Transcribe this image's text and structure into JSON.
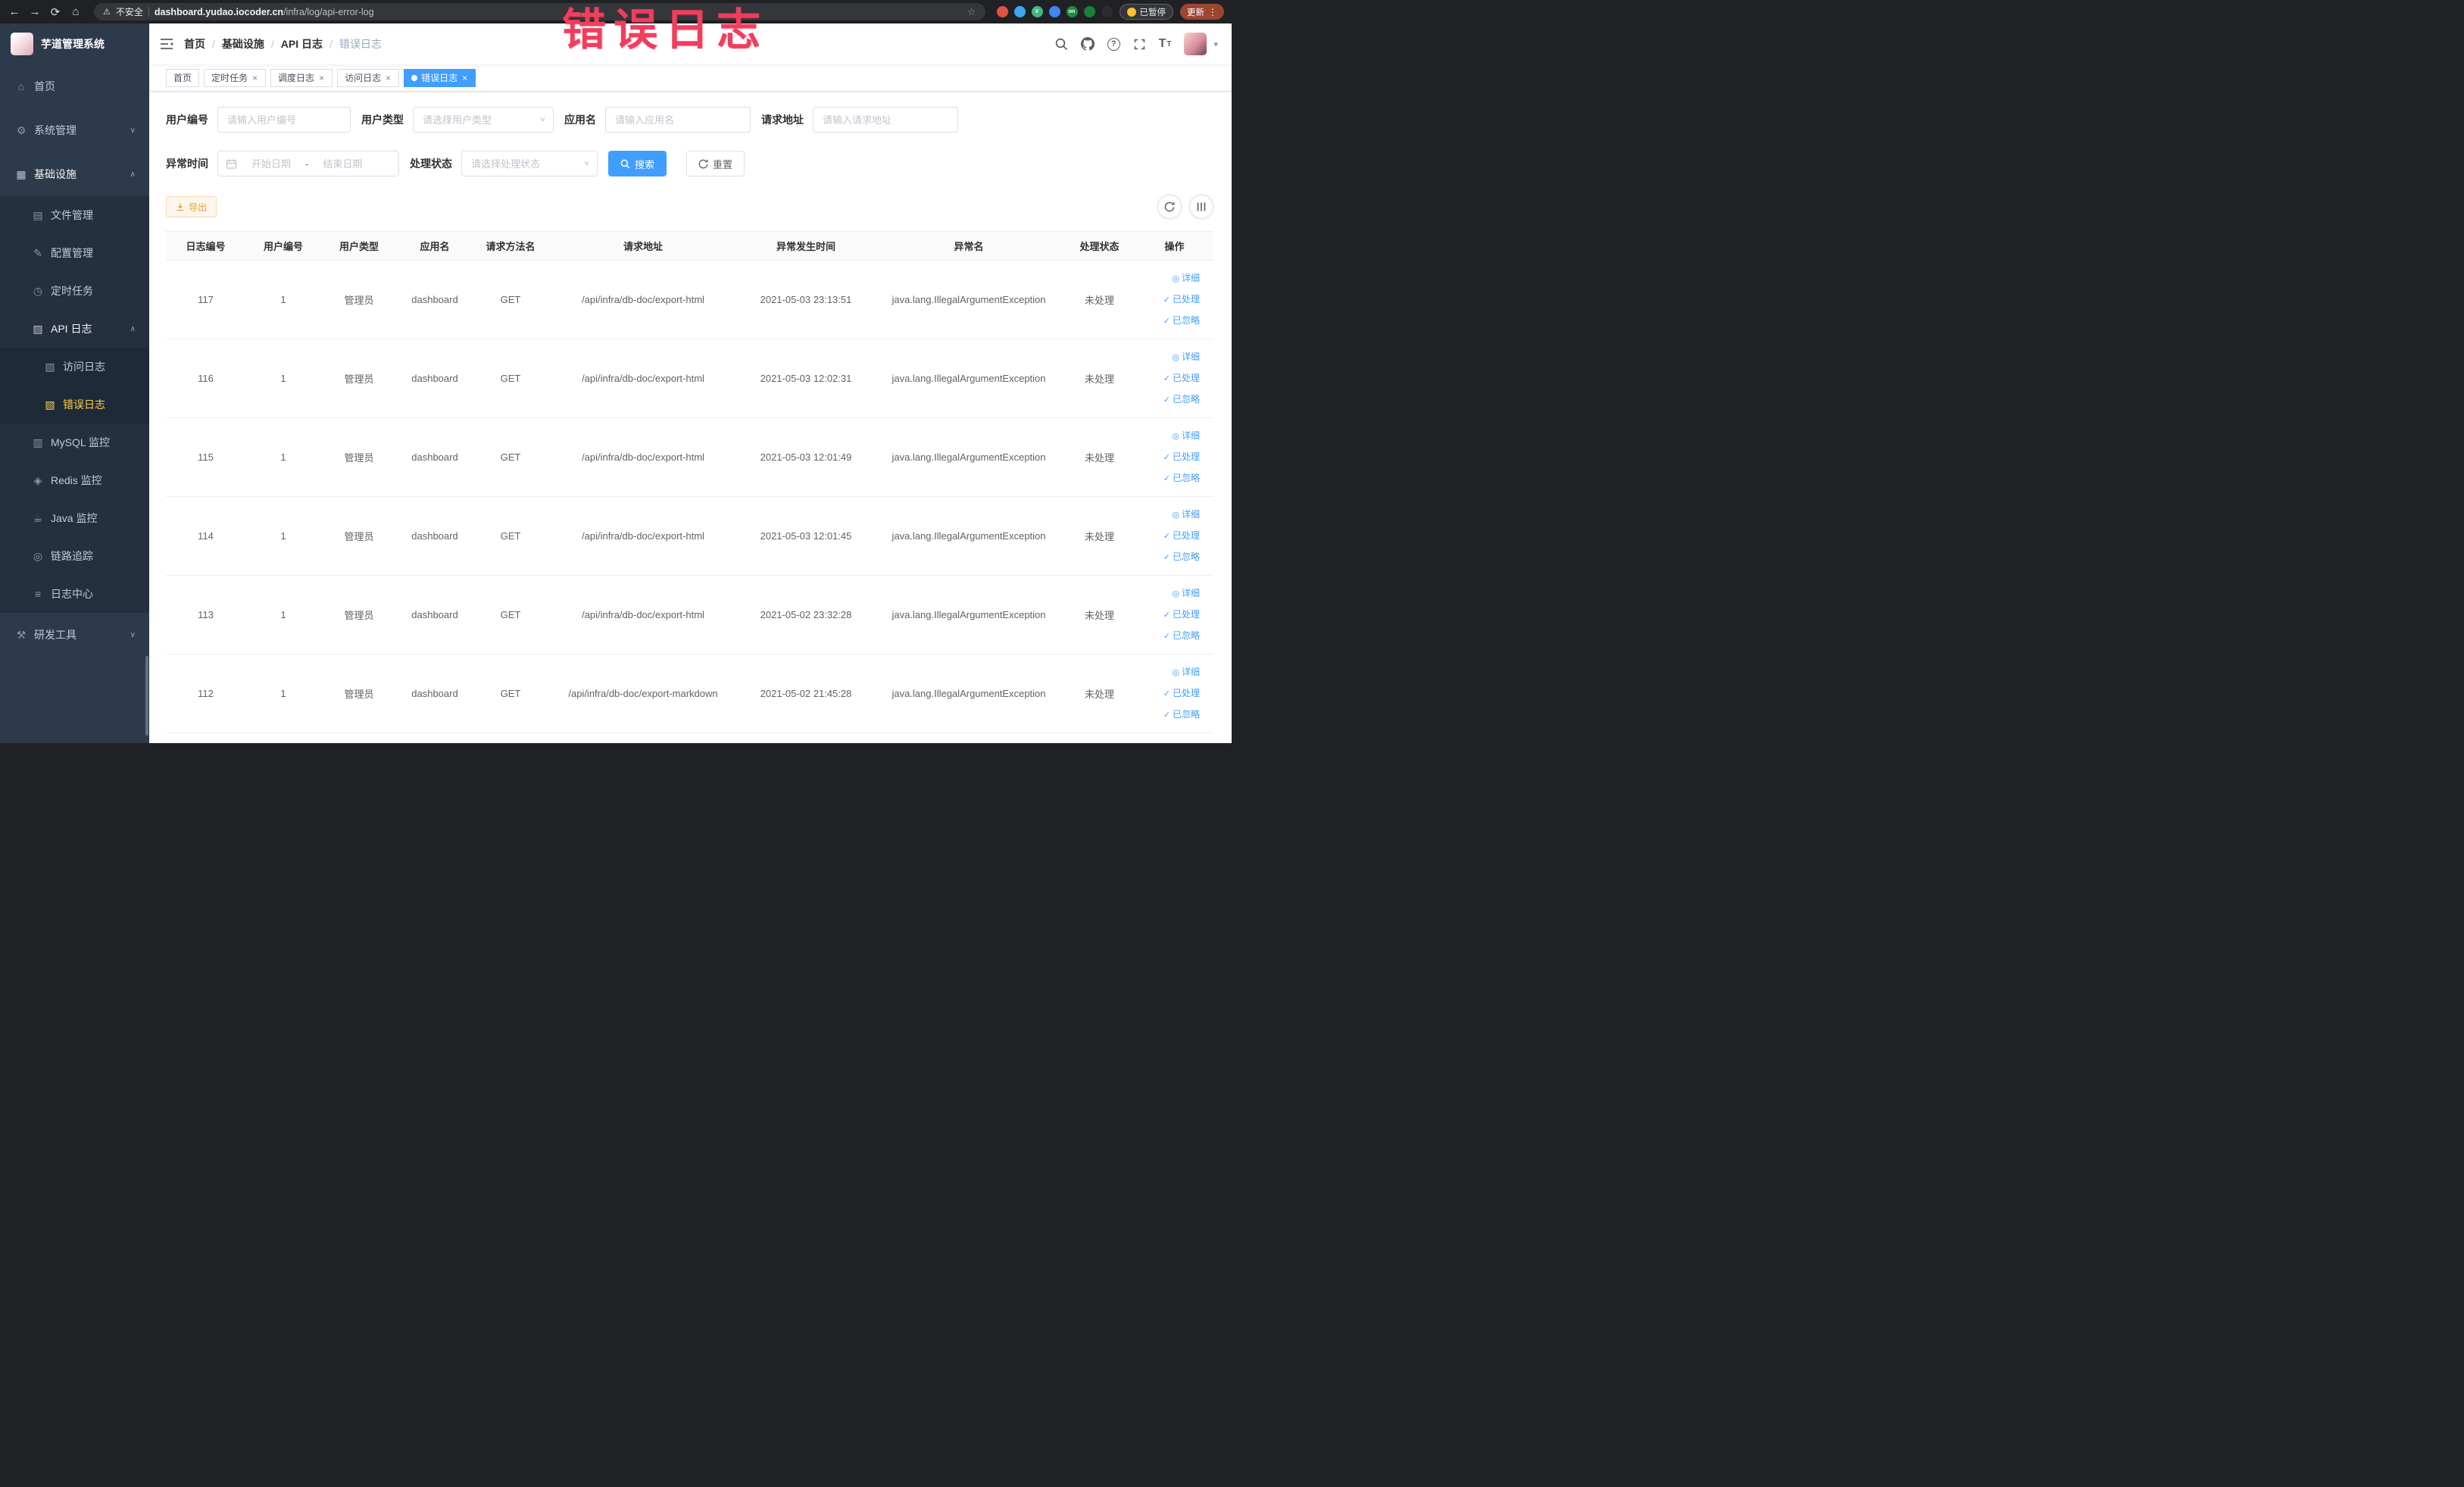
{
  "colors": {
    "accent": "#409eff",
    "active_menu_text": "#ffd04b",
    "sidebar_bg": "#2d3a4b",
    "submenu_bg": "#24303f",
    "warning": "#e6a23c",
    "annotation": "#f23d5d"
  },
  "browser": {
    "security_label": "不安全",
    "url_host": "dashboard.yudao.iocoder.cn",
    "url_path": "/infra/log/api-error-log",
    "paused_label": "已暂停",
    "update_label": "更新",
    "extensions": [
      {
        "name": "extension-icon-red",
        "color": "#e25241"
      },
      {
        "name": "extension-icon-blue-drop",
        "color": "#3ba7f0"
      },
      {
        "name": "extension-icon-vue",
        "color": "#41b883",
        "text": "V"
      },
      {
        "name": "extension-icon-grid",
        "color": "#4285f4"
      },
      {
        "name": "extension-icon-on",
        "color": "#1e8e3e",
        "text": "on"
      },
      {
        "name": "extension-icon-leaf",
        "color": "#188038"
      },
      {
        "name": "extension-icon-paw",
        "color": "#2d2d2d"
      }
    ]
  },
  "annotation": {
    "text": "错误日志",
    "color": "#f23d5d"
  },
  "icons": {
    "home-icon": "⌂",
    "gear-icon": "⚙",
    "infra-icon": "▦",
    "file-icon": "▤",
    "config-icon": "✎",
    "job-icon": "◷",
    "api-log-icon": "▨",
    "access-log-icon": "▧",
    "error-log-icon": "▧",
    "mysql-icon": "▥",
    "redis-icon": "◈",
    "java-icon": "☕",
    "trace-icon": "◎",
    "log-center-icon": "≡",
    "tools-icon": "⚒",
    "eye-icon": "◎",
    "check-icon": "✓",
    "arrow-up": "∧",
    "arrow-down": "∨"
  },
  "sidebar": {
    "logo_title": "芋道管理系统",
    "items": [
      {
        "name": "home",
        "label": "首页",
        "icon": "home-icon",
        "level": 0
      },
      {
        "name": "system",
        "label": "系统管理",
        "icon": "gear-icon",
        "level": 0,
        "arrow": "down"
      },
      {
        "name": "infra",
        "label": "基础设施",
        "icon": "infra-icon",
        "level": 0,
        "arrow": "up",
        "open": true
      },
      {
        "name": "file-manage",
        "label": "文件管理",
        "icon": "file-icon",
        "level": 1
      },
      {
        "name": "config-manage",
        "label": "配置管理",
        "icon": "config-icon",
        "level": 1
      },
      {
        "name": "scheduled-job",
        "label": "定时任务",
        "icon": "job-icon",
        "level": 1
      },
      {
        "name": "api-log",
        "label": "API 日志",
        "icon": "api-log-icon",
        "level": 1,
        "arrow": "up",
        "open": true
      },
      {
        "name": "access-log",
        "label": "访问日志",
        "icon": "access-log-icon",
        "level": 2
      },
      {
        "name": "error-log",
        "label": "错误日志",
        "icon": "error-log-icon",
        "level": 2,
        "active": true
      },
      {
        "name": "mysql-monitor",
        "label": "MySQL 监控",
        "icon": "mysql-icon",
        "level": 1
      },
      {
        "name": "redis-monitor",
        "label": "Redis 监控",
        "icon": "redis-icon",
        "level": 1
      },
      {
        "name": "java-monitor",
        "label": "Java 监控",
        "icon": "java-icon",
        "level": 1
      },
      {
        "name": "link-trace",
        "label": "链路追踪",
        "icon": "trace-icon",
        "level": 1
      },
      {
        "name": "log-center",
        "label": "日志中心",
        "icon": "log-center-icon",
        "level": 1
      },
      {
        "name": "dev-tools",
        "label": "研发工具",
        "icon": "tools-icon",
        "level": 0,
        "arrow": "down"
      }
    ]
  },
  "header": {
    "breadcrumbs": [
      {
        "name": "crumb-home",
        "label": "首页"
      },
      {
        "name": "crumb-infra",
        "label": "基础设施"
      },
      {
        "name": "crumb-api-log",
        "label": "API 日志"
      },
      {
        "name": "crumb-error-log",
        "label": "错误日志",
        "current": true
      }
    ]
  },
  "tags": [
    {
      "name": "tab-home",
      "label": "首页",
      "closable": false
    },
    {
      "name": "tab-scheduled-job",
      "label": "定时任务",
      "closable": true
    },
    {
      "name": "tab-schedule-log",
      "label": "调度日志",
      "closable": true
    },
    {
      "name": "tab-access-log",
      "label": "访问日志",
      "closable": true
    },
    {
      "name": "tab-error-log",
      "label": "错误日志",
      "closable": true,
      "active": true
    }
  ],
  "filters": {
    "user_id": {
      "label": "用户编号",
      "placeholder": "请输入用户编号"
    },
    "user_type": {
      "label": "用户类型",
      "placeholder": "请选择用户类型"
    },
    "app_name": {
      "label": "应用名",
      "placeholder": "请输入应用名"
    },
    "request_url": {
      "label": "请求地址",
      "placeholder": "请输入请求地址"
    },
    "exception_time": {
      "label": "异常时间",
      "start_placeholder": "开始日期",
      "end_placeholder": "结束日期",
      "separator": "-"
    },
    "process_status": {
      "label": "处理状态",
      "placeholder": "请选择处理状态"
    },
    "search_label": "搜索",
    "reset_label": "重置"
  },
  "toolbar": {
    "export_label": "导出"
  },
  "table": {
    "columns": [
      {
        "key": "id",
        "label": "日志编号"
      },
      {
        "key": "user_id",
        "label": "用户编号"
      },
      {
        "key": "user_type",
        "label": "用户类型"
      },
      {
        "key": "app",
        "label": "应用名"
      },
      {
        "key": "method",
        "label": "请求方法名"
      },
      {
        "key": "url",
        "label": "请求地址"
      },
      {
        "key": "time",
        "label": "异常发生时间"
      },
      {
        "key": "exception",
        "label": "异常名"
      },
      {
        "key": "status",
        "label": "处理状态"
      },
      {
        "key": "actions",
        "label": "操作"
      }
    ],
    "actions": [
      {
        "name": "log-detail-link",
        "label": "详细",
        "icon": "eye-icon"
      },
      {
        "name": "log-processed-link",
        "label": "已处理",
        "icon": "check-icon"
      },
      {
        "name": "log-ignored-link",
        "label": "已忽略",
        "icon": "check-icon"
      }
    ],
    "rows": [
      {
        "id": "117",
        "user_id": "1",
        "user_type": "管理员",
        "app": "dashboard",
        "method": "GET",
        "url": "/api/infra/db-doc/export-html",
        "time": "2021-05-03 23:13:51",
        "exception": "java.lang.IllegalArgumentException",
        "status": "未处理"
      },
      {
        "id": "116",
        "user_id": "1",
        "user_type": "管理员",
        "app": "dashboard",
        "method": "GET",
        "url": "/api/infra/db-doc/export-html",
        "time": "2021-05-03 12:02:31",
        "exception": "java.lang.IllegalArgumentException",
        "status": "未处理"
      },
      {
        "id": "115",
        "user_id": "1",
        "user_type": "管理员",
        "app": "dashboard",
        "method": "GET",
        "url": "/api/infra/db-doc/export-html",
        "time": "2021-05-03 12:01:49",
        "exception": "java.lang.IllegalArgumentException",
        "status": "未处理"
      },
      {
        "id": "114",
        "user_id": "1",
        "user_type": "管理员",
        "app": "dashboard",
        "method": "GET",
        "url": "/api/infra/db-doc/export-html",
        "time": "2021-05-03 12:01:45",
        "exception": "java.lang.IllegalArgumentException",
        "status": "未处理"
      },
      {
        "id": "113",
        "user_id": "1",
        "user_type": "管理员",
        "app": "dashboard",
        "method": "GET",
        "url": "/api/infra/db-doc/export-html",
        "time": "2021-05-02 23:32:28",
        "exception": "java.lang.IllegalArgumentException",
        "status": "未处理"
      },
      {
        "id": "112",
        "user_id": "1",
        "user_type": "管理员",
        "app": "dashboard",
        "method": "GET",
        "url": "/api/infra/db-doc/export-markdown",
        "time": "2021-05-02 21:45:28",
        "exception": "java.lang.IllegalArgumentException",
        "status": "未处理"
      }
    ]
  }
}
